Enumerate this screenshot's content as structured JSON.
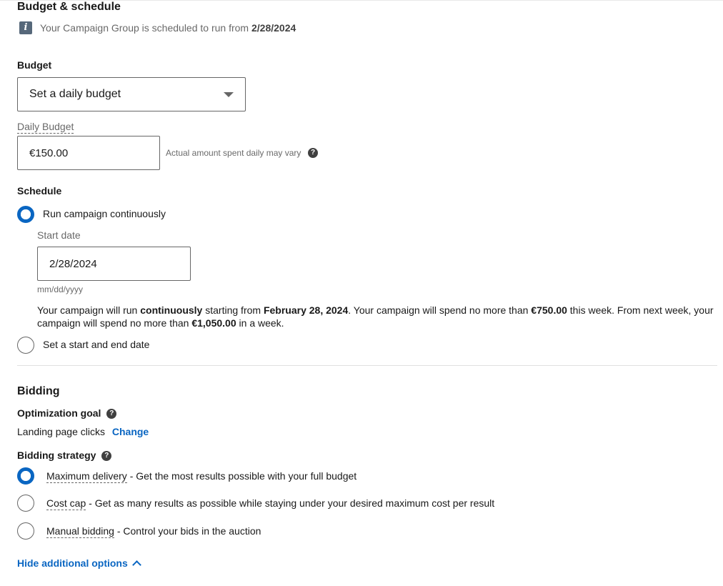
{
  "budget_schedule": {
    "title": "Budget & schedule",
    "info_prefix": "Your Campaign Group is scheduled to run from ",
    "info_date": "2/28/2024",
    "info_icon": "info-icon"
  },
  "budget": {
    "label": "Budget",
    "select_value": "Set a daily budget",
    "daily_label": "Daily Budget",
    "daily_value": "€150.00",
    "daily_note": "Actual amount spent daily may vary"
  },
  "schedule": {
    "label": "Schedule",
    "option_continuous": "Run campaign continuously",
    "start_label": "Start date",
    "start_value": "2/28/2024",
    "date_format": "mm/dd/yyyy",
    "summary": {
      "p1": "Your campaign will run ",
      "b1": "continuously",
      "p2": " starting from ",
      "b2": "February 28, 2024",
      "p3": ". Your campaign will spend no more than ",
      "b3": "€750.00",
      "p4": " this week. From next week, your campaign will spend no more than ",
      "b4": "€1,050.00",
      "p5": " in a week."
    },
    "option_start_end": "Set a start and end date"
  },
  "bidding": {
    "title": "Bidding",
    "goal_label": "Optimization goal",
    "goal_value": "Landing page clicks",
    "goal_change": "Change",
    "strategy_label": "Bidding strategy",
    "options": [
      {
        "name": "Maximum delivery",
        "desc": " - Get the most results possible with your full budget",
        "selected": true
      },
      {
        "name": "Cost cap",
        "desc": " - Get as many results as possible while staying under your desired maximum cost per result",
        "selected": false
      },
      {
        "name": "Manual bidding",
        "desc": " - Control your bids in the auction",
        "selected": false
      }
    ],
    "hide_options": "Hide additional options"
  },
  "colors": {
    "accent": "#0a66c2",
    "text": "#191919",
    "muted": "#666666"
  }
}
